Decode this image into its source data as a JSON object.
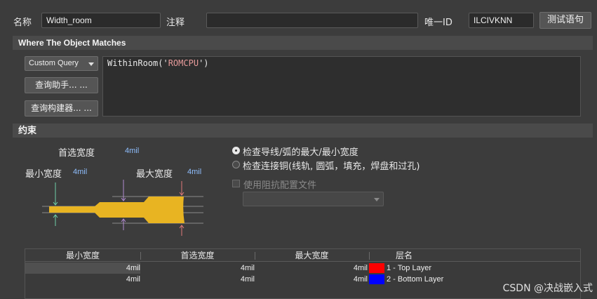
{
  "header": {
    "name_label": "名称",
    "name_value": "Width_room",
    "comment_label": "注释",
    "comment_value": "",
    "uid_label": "唯一ID",
    "uid_value": "ILCIVKNN",
    "test_button": "测试语句"
  },
  "where": {
    "section_title": "Where The Object Matches",
    "query_type": "Custom Query",
    "query_helper_button": "查询助手... ...",
    "query_builder_button": "查询构建器... ...",
    "query_prefix": "WithinRoom('",
    "query_string": "ROMCPU",
    "query_suffix": "')"
  },
  "constraints": {
    "section_title": "约束",
    "preferred_label": "首选宽度",
    "preferred_value": "4mil",
    "min_label": "最小宽度",
    "min_value": "4mil",
    "max_label": "最大宽度",
    "max_value": "4mil",
    "option_check_track": "检查导线/弧的最大/最小宽度",
    "option_check_copper": "检查连接铜(线轨,  圆弧，填充，焊盘和过孔)",
    "impedance_label": "使用阻抗配置文件",
    "impedance_select": ""
  },
  "table": {
    "headers": [
      "最小宽度",
      "首选宽度",
      "最大宽度",
      "层名"
    ],
    "rows": [
      {
        "min": "4mil",
        "preferred": "4mil",
        "max": "4mil",
        "layer": "1 - Top Layer",
        "color": "#ff0000"
      },
      {
        "min": "4mil",
        "preferred": "4mil",
        "max": "4mil",
        "layer": "2 - Bottom Layer",
        "color": "#0000ff"
      }
    ]
  },
  "watermark": "CSDN @决战嵌入式",
  "colors": {
    "trace": "#e8b422",
    "arrow_green": "#6fd0a8",
    "arrow_purple": "#b08ad0",
    "arrow_red": "#e07a7a"
  }
}
